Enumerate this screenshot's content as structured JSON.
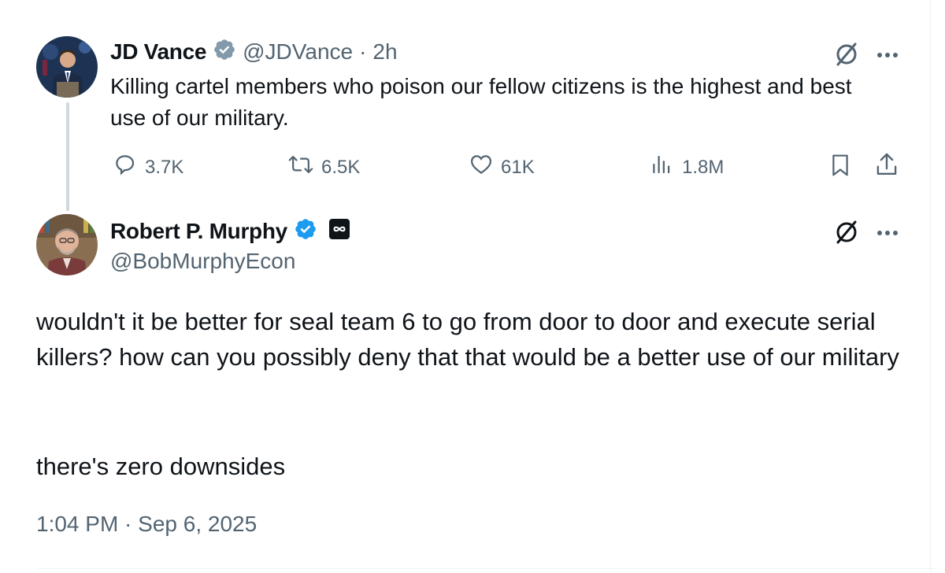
{
  "tweet1": {
    "name": "JD Vance",
    "handle": "@JDVance",
    "separator": "·",
    "time": "2h",
    "text": "Killing cartel members who poison our fellow citizens is the highest and best use of our military.",
    "metrics": {
      "replies": "3.7K",
      "reposts": "6.5K",
      "likes": "61K",
      "views": "1.8M"
    }
  },
  "tweet2": {
    "name": "Robert P. Murphy",
    "handle": "@BobMurphyEcon",
    "paragraph1": "wouldn't it be better for seal team 6 to go from door to door and execute serial killers? how can you possibly deny that that would be a better use of our military",
    "paragraph2": "there's zero downsides",
    "timestamp": "1:04 PM · Sep 6, 2025"
  },
  "colors": {
    "verified": "#1d9bf0",
    "gray_verified": "#829aab",
    "text": "#0f1419",
    "muted": "#536471"
  },
  "icons": [
    "grok-icon",
    "more-icon",
    "reply-icon",
    "repost-icon",
    "like-icon",
    "views-icon",
    "bookmark-icon",
    "share-icon",
    "verified-badge-icon",
    "infinity-badge-icon"
  ]
}
